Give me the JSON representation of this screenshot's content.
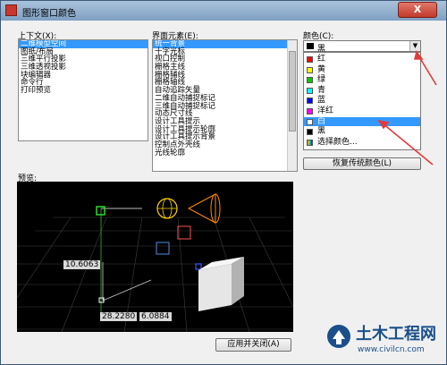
{
  "window": {
    "title": "图形窗口颜色",
    "close_symbol": "X"
  },
  "context": {
    "label": "上下文(X):",
    "items": [
      "二维模型空间",
      "图纸/布局",
      "三维平行投影",
      "三维透视投影",
      "块编辑器",
      "命令行",
      "打印预览"
    ],
    "selected_index": 0
  },
  "interface": {
    "label": "界面元素(E):",
    "items": [
      "统一背景",
      "十字光标",
      "视口控制",
      "栅格主线",
      "栅格辅线",
      "栅格轴线",
      "自动追踪矢量",
      "二维自动捕捉标记",
      "三维自动捕捉标记",
      "动态尺寸线",
      "设计工具提示",
      "设计工具提示轮廓",
      "设计工具提示背景",
      "控制点外壳线",
      "光线轮廓"
    ],
    "selected_index": 0
  },
  "color": {
    "label": "颜色(C):",
    "current_value": "黑",
    "current_color": "#000000",
    "options": [
      {
        "name": "红",
        "color": "#ff0000"
      },
      {
        "name": "黄",
        "color": "#ffff00"
      },
      {
        "name": "绿",
        "color": "#00cc00"
      },
      {
        "name": "青",
        "color": "#00ffff"
      },
      {
        "name": "蓝",
        "color": "#0000ff"
      },
      {
        "name": "洋红",
        "color": "#ff00ff"
      },
      {
        "name": "白",
        "color": "#ffffff"
      },
      {
        "name": "黑",
        "color": "#000000"
      },
      {
        "name": "选择颜色...",
        "color": "multi"
      }
    ],
    "highlighted_index": 6
  },
  "restore_button": "恢复传统颜色(L)",
  "preview": {
    "label": "预览:",
    "dim1": "10.6063",
    "dim2": "28.2280",
    "dim3": "6.0884"
  },
  "apply_button": "应用并关闭(A)",
  "watermark": {
    "name": "土木工程网",
    "url": "www.civilcn.com"
  },
  "colors": {
    "accent": "#3399ff",
    "annotation_arrow": "#e03c3c",
    "watermark_text": "#1a4f8a"
  }
}
